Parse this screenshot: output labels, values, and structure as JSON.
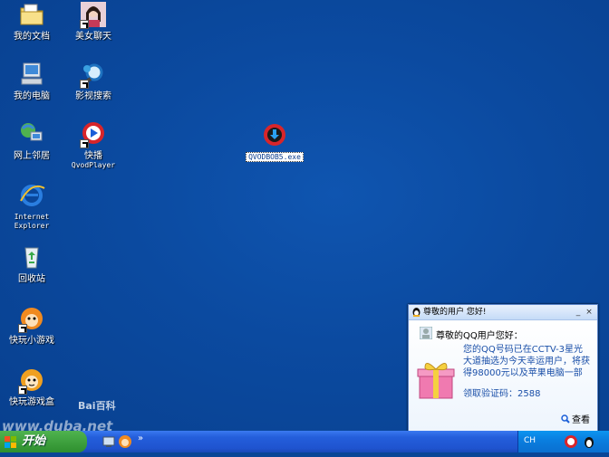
{
  "desktop": {
    "icons": [
      {
        "label": "我的文档"
      },
      {
        "label": "美女聊天"
      },
      {
        "label": "我的电脑"
      },
      {
        "label": "影视搜索"
      },
      {
        "label": "网上邻居"
      },
      {
        "label": "快播",
        "sublabel": "QvodPlayer"
      },
      {
        "label": "Internet",
        "sublabel": "Explorer"
      },
      {
        "label": "回收站"
      },
      {
        "label": "快玩小游戏"
      },
      {
        "label": "快玩游戏盒"
      }
    ],
    "exe_file": {
      "label": "QVODBOB5.exe"
    }
  },
  "popup": {
    "title": "尊敬的用户 您好!",
    "greeting": "尊敬的QQ用户您好：",
    "message": "您的QQ号码已在CCTV-3星光大道抽选为今天幸运用户，将获得98000元以及苹果电脑一部",
    "code_text": "领取验证码：2588",
    "view_label": "查看",
    "close_label": "×",
    "min_label": "_"
  },
  "taskbar": {
    "start_label": "开始",
    "tray_lang": "CH",
    "chevron": "»"
  },
  "watermark": {
    "baidu": "Bai百科",
    "site": "www.duba.net"
  }
}
